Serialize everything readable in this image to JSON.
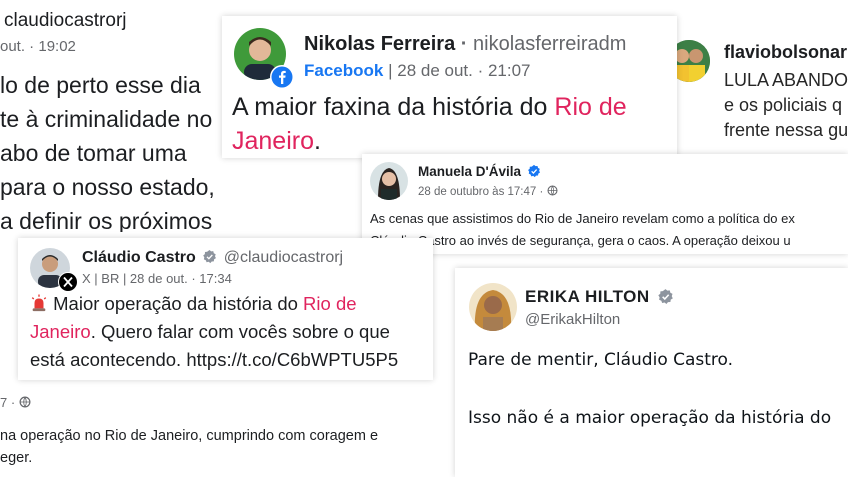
{
  "collage": {
    "post_a": {
      "handle": "claudiocastrorj",
      "meta": "out. · 19:02",
      "lines": [
        "lo de perto esse dia",
        "te à criminalidade no",
        "abo de tomar uma",
        "para o nosso estado,",
        "a definir os próximos"
      ]
    },
    "nikolas": {
      "name": "Nikolas Ferreira",
      "dot": "·",
      "handle": "nikolasferreiradm",
      "platform": "Facebook",
      "meta": "| 28 de out. · 21:07",
      "text_1": "A maior faxina da história do ",
      "text_1_pink": "Rio de",
      "text_2_pink": "Janeiro",
      "text_2_end": "."
    },
    "flavio": {
      "name": "flaviobolsonar",
      "line_1": "LULA ABANDO",
      "line_2": "e os policiais q",
      "line_3": "frente nessa gu"
    },
    "manuela": {
      "name": "Manuela D'Ávila",
      "meta": "28 de outubro às 17:47 ·",
      "line_1": "As cenas que assistimos do Rio de Janeiro revelam como a política do ex",
      "line_2": "Cláudio Castro ao invés de segurança, gera o caos. A operação deixou u"
    },
    "claudio": {
      "name": "Cláudio Castro",
      "handle": "@claudiocastrorj",
      "meta": "X | BR | 28 de out. · 17:34",
      "text_1": " Maior operação da história do ",
      "text_1_pink": "Rio de",
      "text_2_pink": "Janeiro",
      "text_2_rest": ". Quero falar com vocês sobre o que",
      "text_3": "está acontecendo. https://t.co/C6bWPTU5P5"
    },
    "post_b": {
      "meta": "7 ·",
      "line_1": "na operação no Rio de Janeiro, cumprindo com coragem e",
      "line_2": "eger."
    },
    "erika": {
      "name": "ERIKA HILTON",
      "handle": "@ErikakHilton",
      "line_1": "Pare de mentir, Cláudio Castro.",
      "line_2": "Isso não é a maior operação da história do"
    }
  },
  "colors": {
    "pink": "#e0245e",
    "facebook_blue": "#1877f2",
    "verified_blue": "#1d9bf0",
    "muted": "#65676b"
  },
  "icons": [
    "globe-icon",
    "verified-badge-icon",
    "facebook-icon",
    "x-logo-icon",
    "siren-icon"
  ]
}
